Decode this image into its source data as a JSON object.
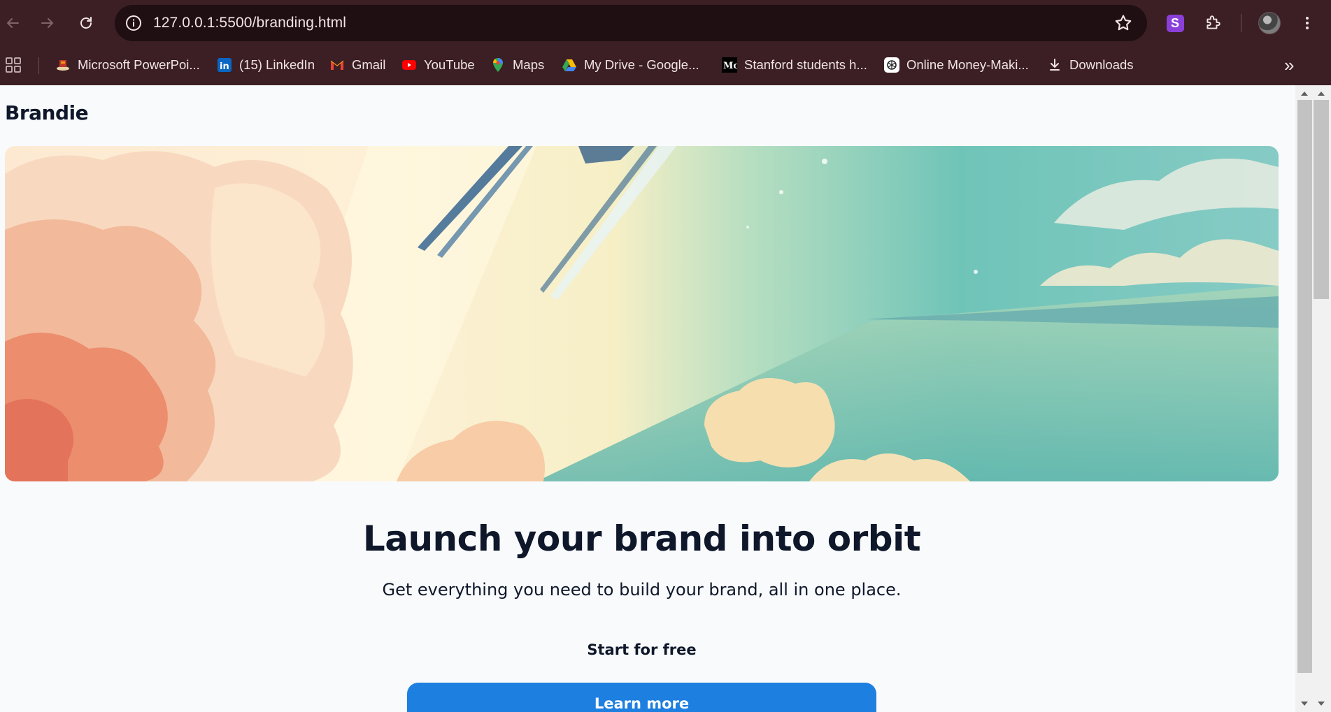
{
  "browser": {
    "url": "127.0.0.1:5500/branding.html",
    "extension_letter": "S",
    "bookmarks": [
      {
        "label": "Microsoft PowerPoi...",
        "icon": "powerpoint-icon"
      },
      {
        "label": "(15) LinkedIn",
        "icon": "linkedin-icon"
      },
      {
        "label": "Gmail",
        "icon": "gmail-icon"
      },
      {
        "label": "YouTube",
        "icon": "youtube-icon"
      },
      {
        "label": "Maps",
        "icon": "maps-icon"
      },
      {
        "label": "My Drive - Google...",
        "icon": "google-drive-icon"
      },
      {
        "label": "Stanford students h...",
        "icon": "medium-icon"
      },
      {
        "label": "Online Money-Maki...",
        "icon": "chatgpt-icon"
      },
      {
        "label": "Downloads",
        "icon": "download-icon"
      }
    ],
    "more_bookmarks_glyph": "»"
  },
  "page": {
    "brand": "Brandie",
    "headline": "Launch your brand into orbit",
    "subheadline": "Get everything you need to build your brand, all in one place.",
    "start_free_label": "Start for free",
    "learn_more_label": "Learn more"
  },
  "colors": {
    "chrome": "#3b1f24",
    "omnibox": "#1f0f12",
    "page_bg": "#f8fafc",
    "accent_button": "#1d7fe0",
    "text_dark": "#0f172a"
  }
}
